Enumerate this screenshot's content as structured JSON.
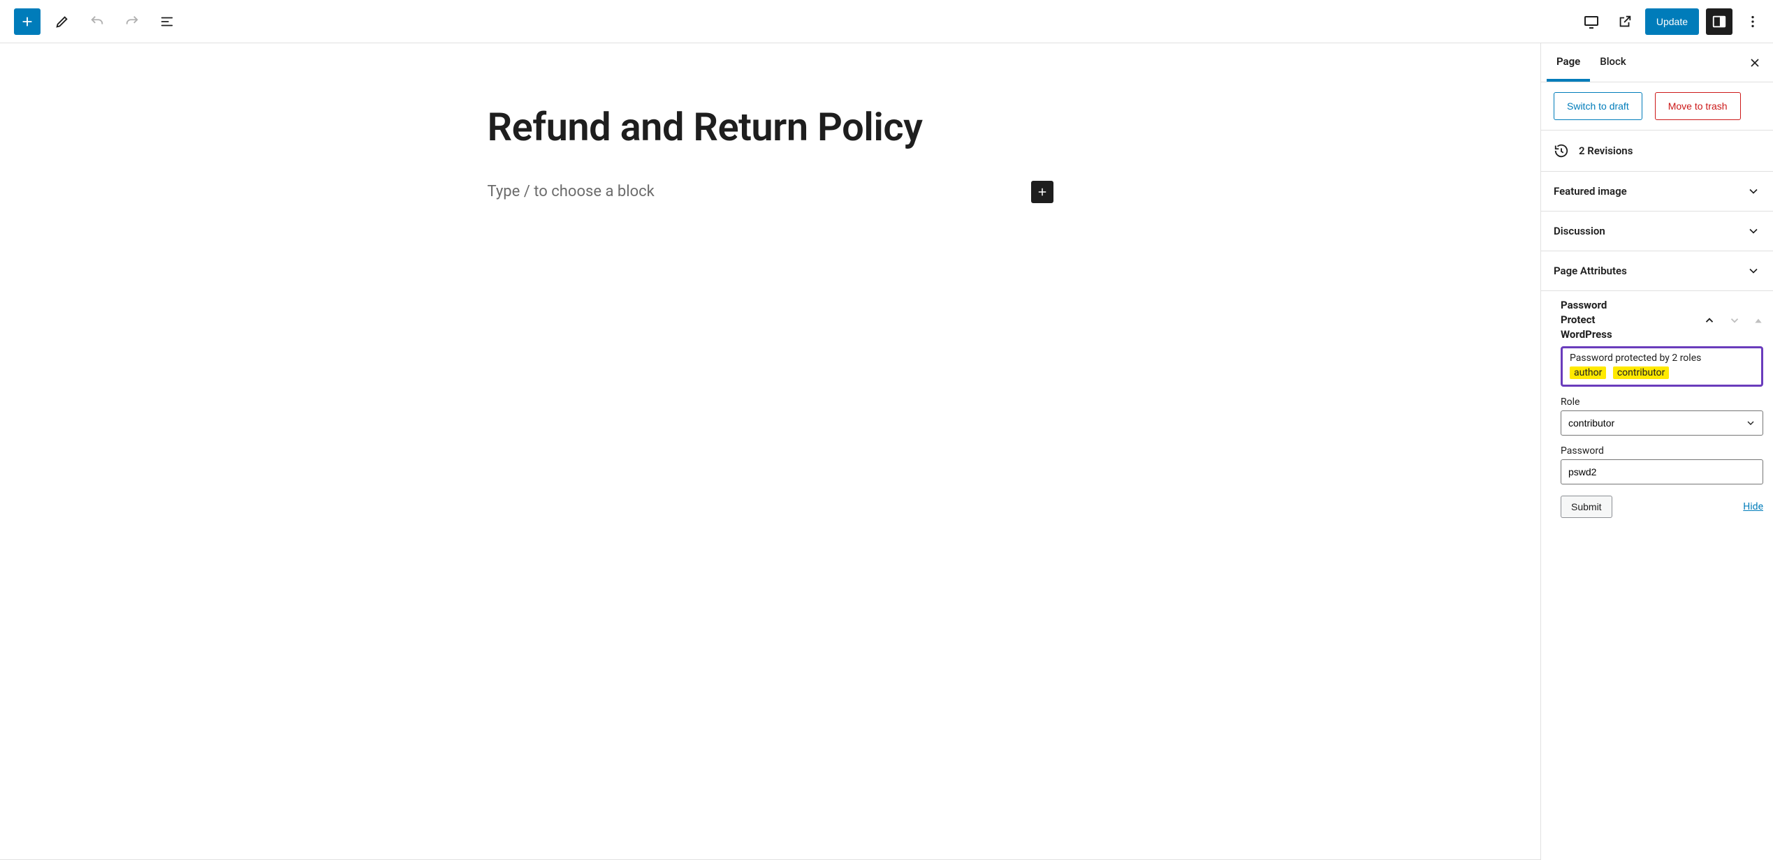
{
  "toolbar": {
    "update_label": "Update"
  },
  "editor": {
    "page_title": "Refund and Return Policy",
    "block_placeholder": "Type / to choose a block"
  },
  "sidebar": {
    "tabs": {
      "page": "Page",
      "block": "Block"
    },
    "actions": {
      "switch_to_draft": "Switch to draft",
      "move_to_trash": "Move to trash"
    },
    "revisions_label": "2 Revisions",
    "panels": {
      "featured_image": "Featured image",
      "discussion": "Discussion",
      "page_attributes": "Page Attributes"
    },
    "ppw": {
      "title_line1": "Password",
      "title_line2": "Protect",
      "title_line3": "WordPress",
      "protected_desc": "Password protected by 2 roles",
      "roles": [
        "author",
        "contributor"
      ],
      "role_label": "Role",
      "role_selected": "contributor",
      "password_label": "Password",
      "password_value": "pswd2",
      "submit_label": "Submit",
      "hide_label": "Hide"
    }
  }
}
